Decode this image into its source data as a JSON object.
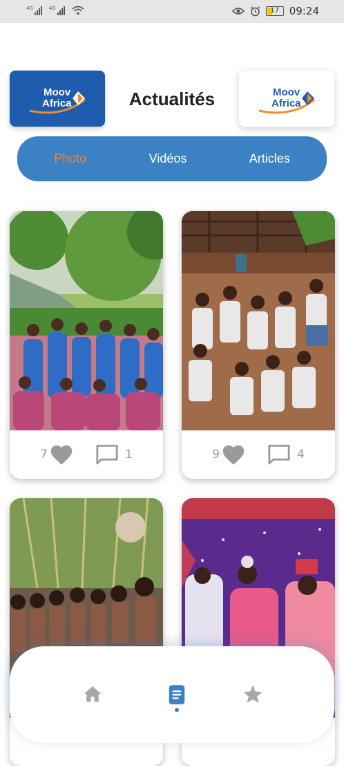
{
  "status_bar": {
    "signal1_label": "4G",
    "signal2_label": "4G",
    "battery": "17",
    "time": "09:24"
  },
  "header": {
    "title": "Actualités",
    "logo_left_text": [
      "Moov",
      "Africa"
    ],
    "logo_right_text": [
      "Moov",
      "Africa"
    ]
  },
  "tabs": [
    {
      "label": "Photo",
      "active": true
    },
    {
      "label": "Vidéos",
      "active": false
    },
    {
      "label": "Articles",
      "active": false
    }
  ],
  "posts": [
    {
      "likes": "7",
      "comments": "1"
    },
    {
      "likes": "9",
      "comments": "4"
    },
    {
      "likes": "",
      "comments": ""
    },
    {
      "likes": "",
      "comments": ""
    }
  ],
  "bottom_nav": [
    {
      "icon": "home-icon",
      "active": false
    },
    {
      "icon": "document-icon",
      "active": true
    },
    {
      "icon": "star-icon",
      "active": false
    }
  ],
  "colors": {
    "accent_blue": "#3b82c4",
    "active_tab": "#e8873d",
    "logo_blue": "#1e5cae"
  }
}
